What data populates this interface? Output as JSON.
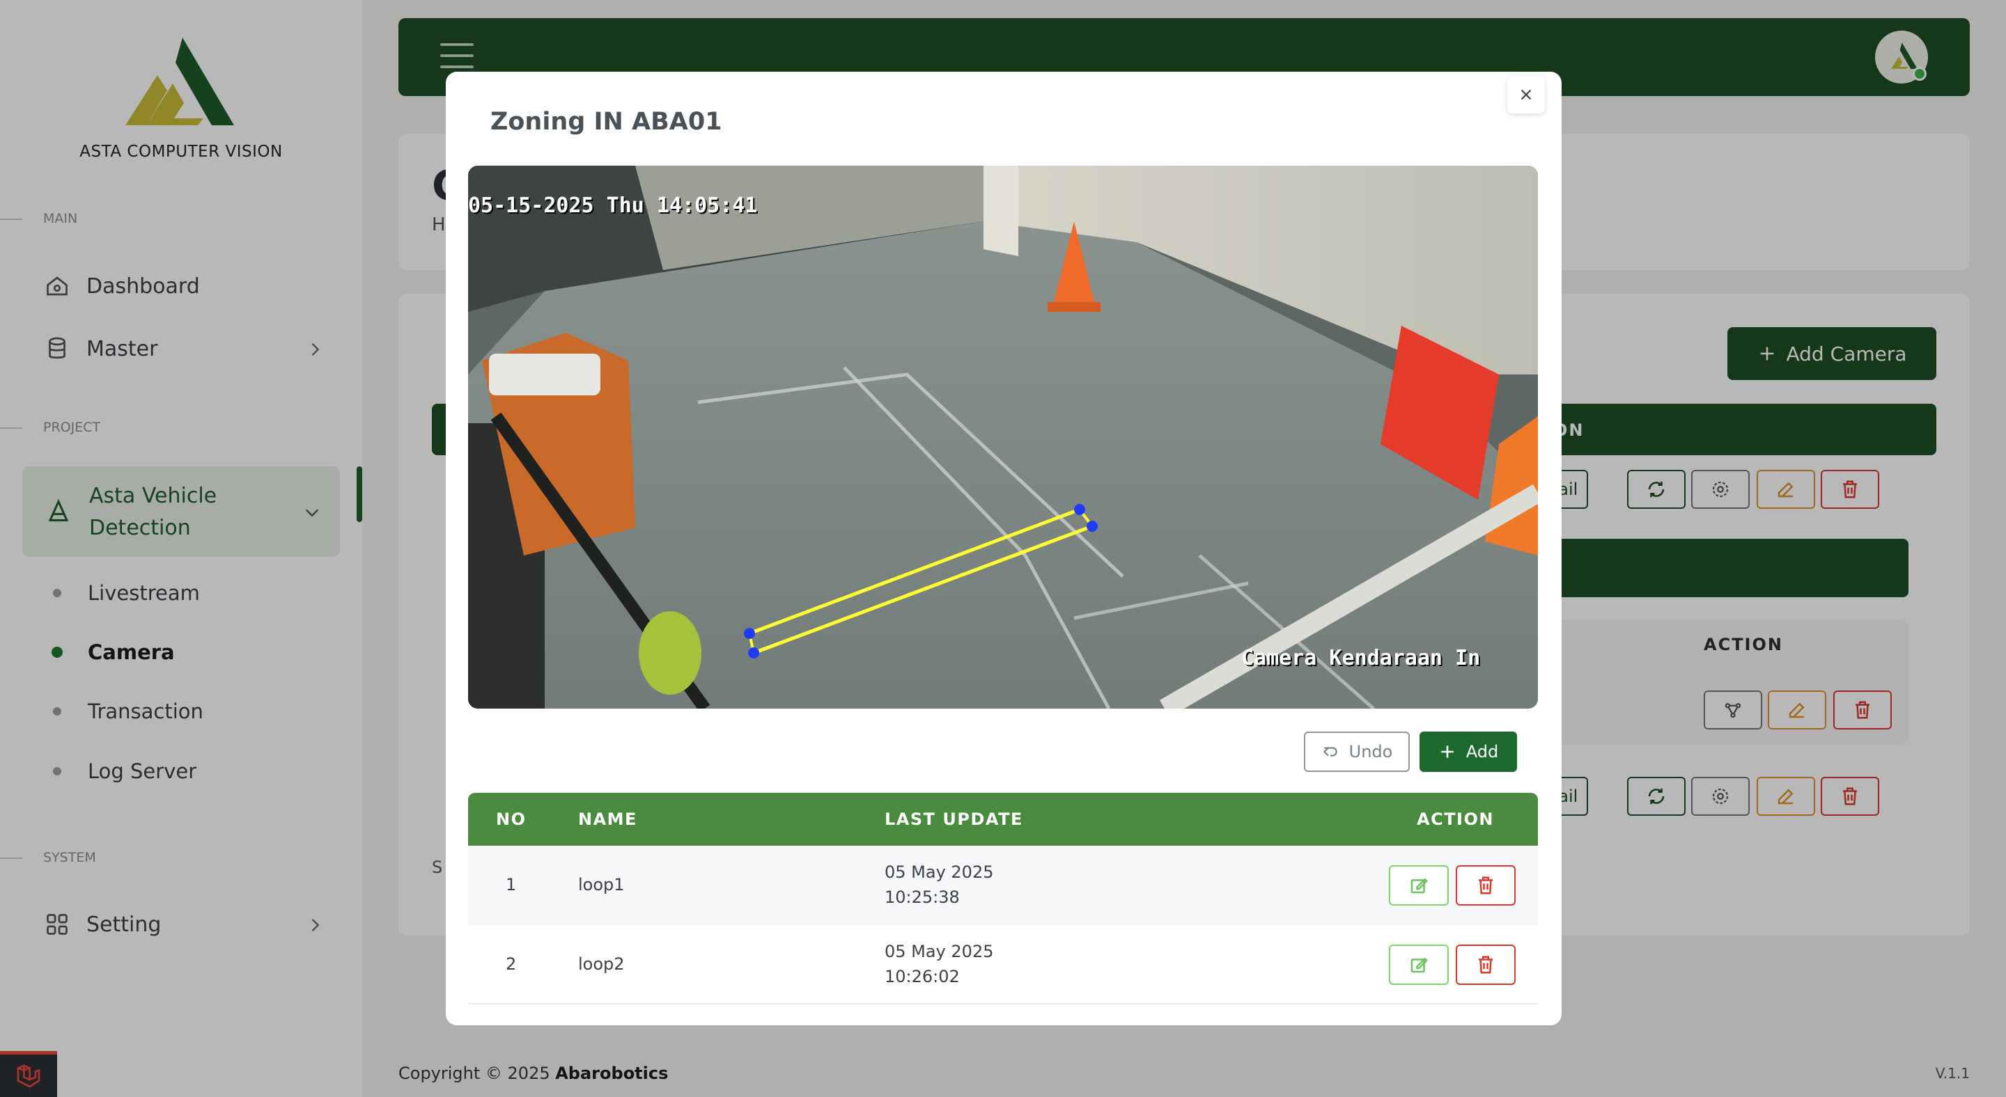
{
  "sidebar": {
    "brand": "ASTA COMPUTER VISION",
    "sections": {
      "main": "MAIN",
      "project": "PROJECT",
      "system": "SYSTEM"
    },
    "items": {
      "dashboard": "Dashboard",
      "master": "Master",
      "project_line1": "Asta Vehicle",
      "project_line2": "Detection",
      "setting": "Setting"
    },
    "subitems": {
      "livestream": "Livestream",
      "camera": "Camera",
      "transaction": "Transaction",
      "log_server": "Log Server"
    },
    "active_subitem": "Camera"
  },
  "background": {
    "heading_initial": "C",
    "breadcrumb_initial": "H",
    "show_initial": "S",
    "add_camera": "Add Camera",
    "table_header_suffix": "ON",
    "nested_action_header": "ACTION",
    "detail_label": "Detail"
  },
  "footer": {
    "copyright_prefix": "Copyright © 2025 ",
    "company": "Abarobotics",
    "version": "V.1.1"
  },
  "modal": {
    "title": "Zoning IN ABA01",
    "camera": {
      "timestamp": "05-15-2025 Thu 14:05:41",
      "caption": "Camera Kendaraan In",
      "zone_color": "#ffff33",
      "point_color": "#1f3bff"
    },
    "buttons": {
      "undo": "Undo",
      "add": "Add"
    },
    "table": {
      "headers": {
        "no": "NO",
        "name": "NAME",
        "last_update": "LAST UPDATE",
        "action": "ACTION"
      },
      "rows": [
        {
          "no": "1",
          "name": "loop1",
          "date": "05 May 2025",
          "time": "10:25:38"
        },
        {
          "no": "2",
          "name": "loop2",
          "date": "05 May 2025",
          "time": "10:26:02"
        }
      ]
    }
  },
  "colors": {
    "primary": "#1e4d24",
    "table_header": "#4b8b40",
    "danger": "#d9382f",
    "edit": "#7ed36e",
    "warning": "#e0932a"
  }
}
